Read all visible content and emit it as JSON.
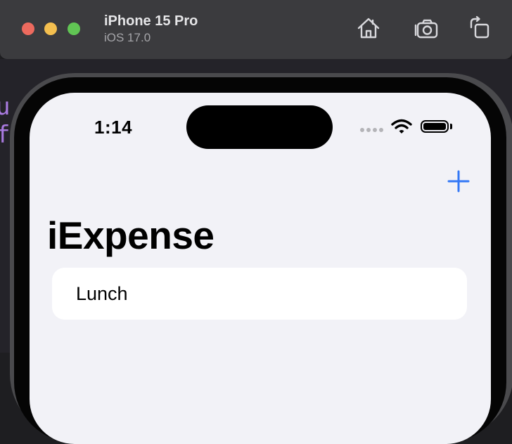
{
  "window": {
    "title": "iPhone 15 Pro",
    "subtitle": "iOS 17.0",
    "traffic_lights": {
      "close": "#ed6a5e",
      "minimize": "#f4bf4f",
      "zoom": "#61c554"
    },
    "toolbar_icons": [
      "home-icon",
      "screenshot-icon",
      "rotate-icon"
    ]
  },
  "status_bar": {
    "time": "1:14",
    "icons": [
      "cellular-signal-icon",
      "wifi-icon",
      "battery-icon"
    ]
  },
  "app": {
    "title": "iExpense",
    "add_button_icon": "plus-icon",
    "accent_color": "#3478f6",
    "items": [
      {
        "name": "Lunch"
      }
    ]
  }
}
